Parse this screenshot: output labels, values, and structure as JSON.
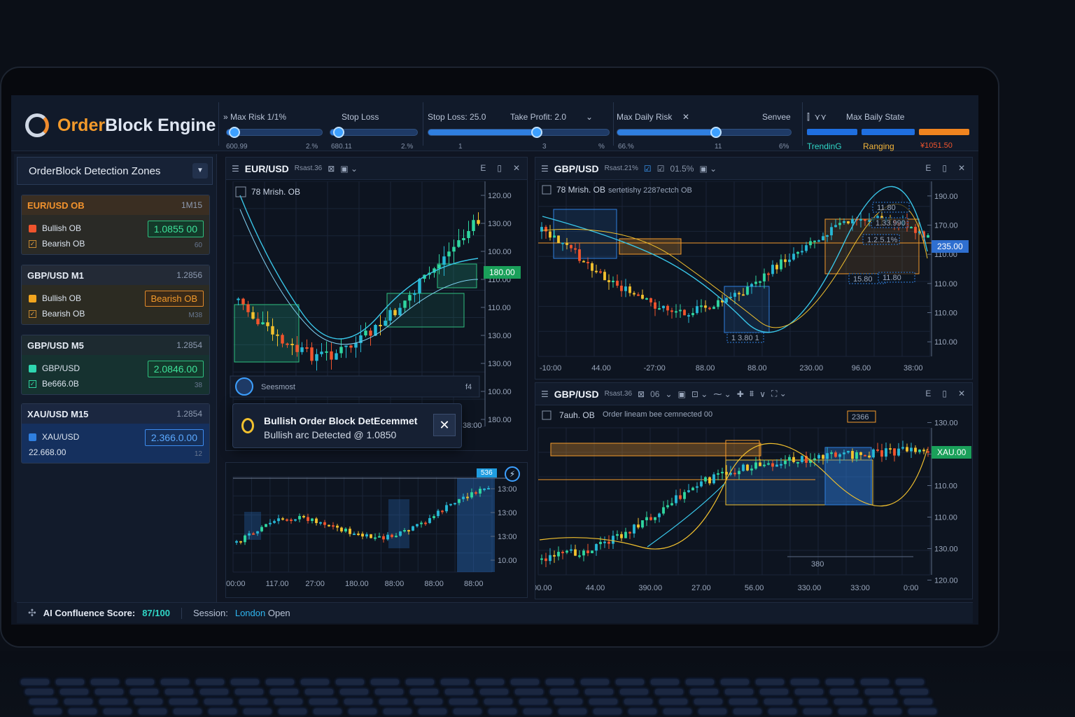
{
  "app": {
    "title_part1": "Order",
    "title_part2": "Block Engine"
  },
  "header": {
    "max_risk": "Max Risk 1/1%",
    "stop_loss": "Stop Loss",
    "stop_loss_val": "Stop Loss: 25.0",
    "take_profit": "Take Profit: 2.0",
    "max_daily": "Max Daily Risk",
    "senvee": "Senvee",
    "max_baily": "Max Baily State",
    "t1a": "600.99",
    "t1b": "2.%",
    "t2a": "680.11",
    "t2b": "2.%",
    "t3a": "1",
    "t3b": "3",
    "t3c": "%",
    "t4a": "66.%",
    "t4b": "11",
    "t4c": "6%",
    "state_trending": "TrendinG",
    "state_ranging": "Ranging",
    "state_val": "¥1051.50",
    "risk_value": 0.08,
    "stop_value": 0.1,
    "tp_value": 0.6,
    "daily_value": 0.57
  },
  "sidebar": {
    "title": "OrderBlock Detection Zones",
    "cards": [
      {
        "pair": "EUR/USD OB",
        "tf": "1M15",
        "row1": "Bullish OB",
        "row2": "Bearish OB",
        "value": "1.0855 00",
        "dim": "60"
      },
      {
        "pair": "GBP/USD M1",
        "tf": "1.2856",
        "row1": "Bullish OB",
        "row2": "Bearish OB",
        "value": "Bearish OB",
        "dim": "M38"
      },
      {
        "pair": "GBP/USD M5",
        "tf": "1.2854",
        "row1": "GBP/USD",
        "row2": "Be666.0B",
        "value": "2.0846.00",
        "dim": "38"
      },
      {
        "pair": "XAU/USD M15",
        "tf": "1.2854",
        "row1": "XAU/USD",
        "row2": "22.668.00",
        "value": "2.366.0.00",
        "dim": "12"
      }
    ]
  },
  "panel_eur": {
    "symbol": "EUR/USD",
    "sub": "Rsast.36",
    "tag": "78 Mrish. OB",
    "price_tag": "180.00",
    "yticks": [
      "120.00",
      "130.00",
      "100.00",
      "110.00",
      "110.00",
      "130.00",
      "130.00",
      "100.00",
      "180.00"
    ],
    "xlast": "38:00",
    "bottom_label": "Seesmost",
    "bottom_right": "f4"
  },
  "panel_gbp1": {
    "symbol": "GBP/USD",
    "sub": "Rsast.21%",
    "pct": "01.5%",
    "tag": "78 Mrish. OB",
    "tag2": "sertetishy 2287ectch OB",
    "price_tag": "235.00",
    "yticks": [
      "190.00",
      "170.00",
      "110.00",
      "110.00",
      "110.00",
      "110.00"
    ],
    "xticks": [
      "-10:00",
      "44.00",
      "-27:00",
      "88.00",
      "88.00",
      "230.00",
      "96.00",
      "38:00"
    ],
    "box_labels": [
      "11.80",
      "1.33.990",
      "1.2.5.1%",
      "15.80",
      "11.80",
      "1 3.80 1"
    ]
  },
  "panel_gbp2": {
    "symbol": "GBP/USD",
    "sub": "Rsast.36",
    "zoom": "06",
    "tag": "7auh. OB",
    "tag2": "Order lineam bee cemnected 00",
    "box_label": "2366",
    "price_tag": "XAU.00",
    "yticks": [
      "130.00",
      "130.00",
      "110.00",
      "110.00",
      "130.00",
      "120.00"
    ],
    "xticks": [
      "00.00",
      "44.00",
      "390.00",
      "27.00",
      "56.00",
      "330.00",
      "33:00",
      "0:00"
    ],
    "small_tag": "380"
  },
  "panel_mini": {
    "price_tag": "536",
    "yticks": [
      "13:00",
      "13:00",
      "13:00",
      "10.00"
    ],
    "xticks": [
      "00:00",
      "117.00",
      "27:00",
      "180.00",
      "88:00",
      "88:00",
      "88:00"
    ]
  },
  "toast": {
    "title": "Bullish Order Block DetEcemmet",
    "subtitle": "Bullish arc Detected @ 1.0850"
  },
  "footer": {
    "label": "AI Confluence Score:",
    "score": "87/100",
    "session": "Session:",
    "london": "London",
    "open": "Open"
  },
  "colors": {
    "bull": "#2fd6a0",
    "bear": "#f0542d",
    "accent": "#f39a2b",
    "blue": "#2f7fe0"
  }
}
